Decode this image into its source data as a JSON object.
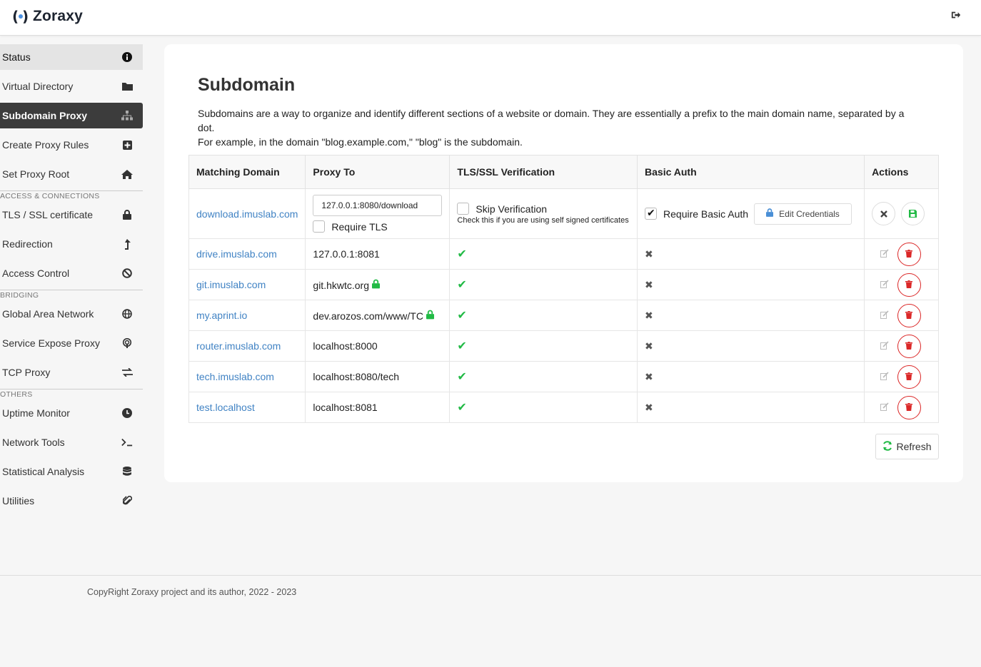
{
  "app": {
    "name": "Zoraxy"
  },
  "sidebar": {
    "items": [
      {
        "label": "Status",
        "icon": "info-icon"
      },
      {
        "label": "Virtual Directory",
        "icon": "folder-icon"
      },
      {
        "label": "Subdomain Proxy",
        "icon": "sitemap-icon"
      },
      {
        "label": "Create Proxy Rules",
        "icon": "plus-square-icon"
      },
      {
        "label": "Set Proxy Root",
        "icon": "home-icon"
      }
    ],
    "section_access": "ACCESS & CONNECTIONS",
    "access_items": [
      {
        "label": "TLS / SSL certificate",
        "icon": "lock-icon"
      },
      {
        "label": "Redirection",
        "icon": "level-up-icon"
      },
      {
        "label": "Access Control",
        "icon": "ban-icon"
      }
    ],
    "section_bridging": "BRIDGING",
    "bridging_items": [
      {
        "label": "Global Area Network",
        "icon": "globe-icon"
      },
      {
        "label": "Service Expose Proxy",
        "icon": "podcast-icon"
      },
      {
        "label": "TCP Proxy",
        "icon": "exchange-icon"
      }
    ],
    "section_others": "OTHERS",
    "other_items": [
      {
        "label": "Uptime Monitor",
        "icon": "clock-icon"
      },
      {
        "label": "Network Tools",
        "icon": "terminal-icon"
      },
      {
        "label": "Statistical Analysis",
        "icon": "database-icon"
      },
      {
        "label": "Utilities",
        "icon": "paperclip-icon"
      }
    ]
  },
  "main": {
    "title": "Subdomain",
    "description_line1": "Subdomains are a way to organize and identify different sections of a website or domain. They are essentially a prefix to the main domain name, separated by a dot.",
    "description_line2": "For example, in the domain \"blog.example.com,\" \"blog\" is the subdomain.",
    "table": {
      "headers": [
        "Matching Domain",
        "Proxy To",
        "TLS/SSL Verification",
        "Basic Auth",
        "Actions"
      ],
      "edit_row": {
        "domain": "download.imuslab.com",
        "proxy_value": "127.0.0.1:8080/download",
        "require_tls_label": "Require TLS",
        "skip_verification_label": "Skip Verification",
        "skip_hint": "Check this if you are using self signed certificates",
        "require_basic_auth_label": "Require Basic Auth",
        "edit_credentials_label": "Edit Credentials"
      },
      "rows": [
        {
          "domain": "drive.imuslab.com",
          "proxy": "127.0.0.1:8081",
          "tls_lock": false
        },
        {
          "domain": "git.imuslab.com",
          "proxy": "git.hkwtc.org",
          "tls_lock": true
        },
        {
          "domain": "my.aprint.io",
          "proxy": "dev.arozos.com/www/TC",
          "tls_lock": true
        },
        {
          "domain": "router.imuslab.com",
          "proxy": "localhost:8000",
          "tls_lock": false
        },
        {
          "domain": "tech.imuslab.com",
          "proxy": "localhost:8080/tech",
          "tls_lock": false
        },
        {
          "domain": "test.localhost",
          "proxy": "localhost:8081",
          "tls_lock": false
        }
      ]
    },
    "refresh_label": "Refresh"
  },
  "footer": {
    "text": "CopyRight Zoraxy project and its author, 2022 - 2023"
  },
  "colors": {
    "accent": "#4183c4",
    "active_nav": "#3c3c3c",
    "ok": "#21ba45",
    "danger": "#db2828"
  }
}
